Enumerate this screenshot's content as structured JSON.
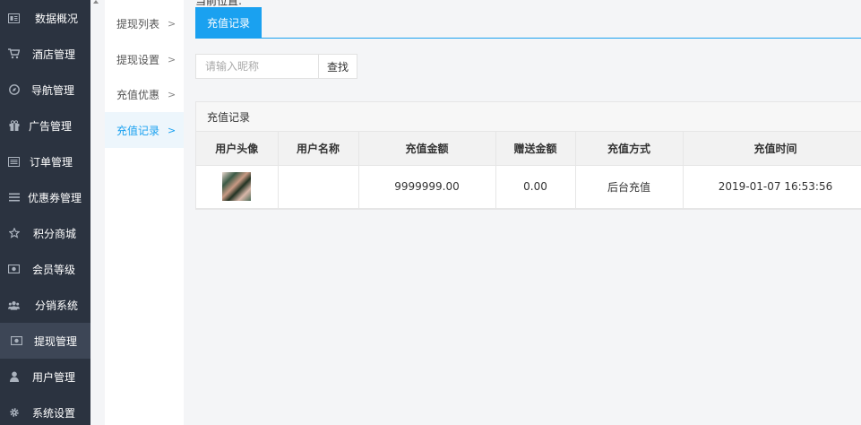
{
  "sidebar": {
    "items": [
      {
        "label": "数据概况",
        "icon": "dashboard-icon",
        "active": false
      },
      {
        "label": "酒店管理",
        "icon": "cart-icon",
        "active": false
      },
      {
        "label": "导航管理",
        "icon": "compass-icon",
        "active": false
      },
      {
        "label": "广告管理",
        "icon": "gift-icon",
        "active": false
      },
      {
        "label": "订单管理",
        "icon": "list-icon",
        "active": false
      },
      {
        "label": "优惠券管理",
        "icon": "menu-icon",
        "active": false
      },
      {
        "label": "积分商城",
        "icon": "star-icon",
        "active": false
      },
      {
        "label": "会员等级",
        "icon": "money-icon",
        "active": false
      },
      {
        "label": "分销系统",
        "icon": "users-icon",
        "active": false
      },
      {
        "label": "提现管理",
        "icon": "money-icon",
        "active": true
      },
      {
        "label": "用户管理",
        "icon": "user-icon",
        "active": false
      },
      {
        "label": "系统设置",
        "icon": "gear-icon",
        "active": false
      }
    ]
  },
  "submenu": {
    "items": [
      {
        "label": "提现列表",
        "active": false
      },
      {
        "label": "提现设置",
        "active": false
      },
      {
        "label": "充值优惠",
        "active": false
      },
      {
        "label": "充值记录",
        "active": true
      }
    ]
  },
  "breadcrumb": "当前位置:",
  "tab": {
    "label": "充值记录"
  },
  "search": {
    "placeholder": "请输入昵称",
    "value": "",
    "button_label": "查找"
  },
  "panel": {
    "title": "充值记录",
    "columns": [
      "用户头像",
      "用户名称",
      "充值金额",
      "赠送金额",
      "充值方式",
      "充值时间"
    ],
    "rows": [
      {
        "avatar": "avatar-photo",
        "name": "",
        "amount": "9999999.00",
        "bonus": "0.00",
        "method": "后台充值",
        "time": "2019-01-07 16:53:56"
      }
    ]
  },
  "colors": {
    "sidebar_bg": "#2b3340",
    "accent": "#1aa1f0"
  }
}
